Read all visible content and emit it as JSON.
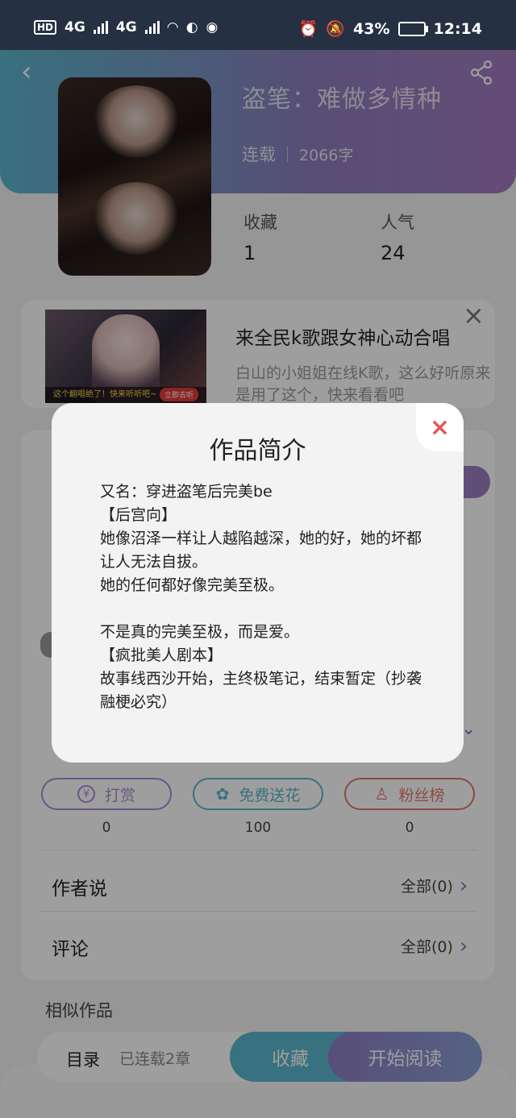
{
  "status_bar": {
    "left_label": "HD",
    "network_left": "4G",
    "network_right": "4G",
    "battery": "43%",
    "time": "12:14"
  },
  "header": {
    "title": "盗笔：难做多情种",
    "status": "连载",
    "word_count": "2066字"
  },
  "stats": [
    {
      "label": "收藏",
      "value": "1"
    },
    {
      "label": "人气",
      "value": "24"
    }
  ],
  "ad": {
    "image_strip": "这个翻唱绝了！快来听听吧~",
    "image_cta": "立即去听",
    "title": "来全民k歌跟女神心动合唱",
    "description": "白山的小姐姐在线K歌，这么好听原来是用了这个，快来看看吧"
  },
  "actions": [
    {
      "label": "打赏",
      "count": "0",
      "color": "#a88bd6",
      "icon": "yen-icon"
    },
    {
      "label": "免费送花",
      "count": "100",
      "color": "#5bb6cd",
      "icon": "flower-icon"
    },
    {
      "label": "粉丝榜",
      "count": "0",
      "color": "#e07a6a",
      "icon": "fan-icon"
    }
  ],
  "rows": [
    {
      "title": "作者说",
      "link": "全部(0)"
    },
    {
      "title": "评论",
      "link": "全部(0)"
    }
  ],
  "similar_title": "相似作品",
  "bottom_bar": {
    "catalog": "目录",
    "chapters": "已连载2章",
    "collect": "收藏",
    "read": "开始阅读"
  },
  "modal": {
    "title": "作品简介",
    "body": "又名：穿进盗笔后完美be\n【后宫向】\n她像沼泽一样让人越陷越深，她的好，她的坏都让人无法自拔。\n她的任何都好像完美至极。\n\n不是真的完美至极，而是爱。\n【疯批美人剧本】\n故事线西沙开始，主终极笔记，结束暂定（抄袭融梗必究）",
    "close": "×"
  },
  "colors": {
    "header_gradient_start": "#5bb6cd",
    "header_gradient_end": "#a47bbf",
    "accent_purple": "#8b6fc4",
    "close_red": "#e05a5a"
  }
}
